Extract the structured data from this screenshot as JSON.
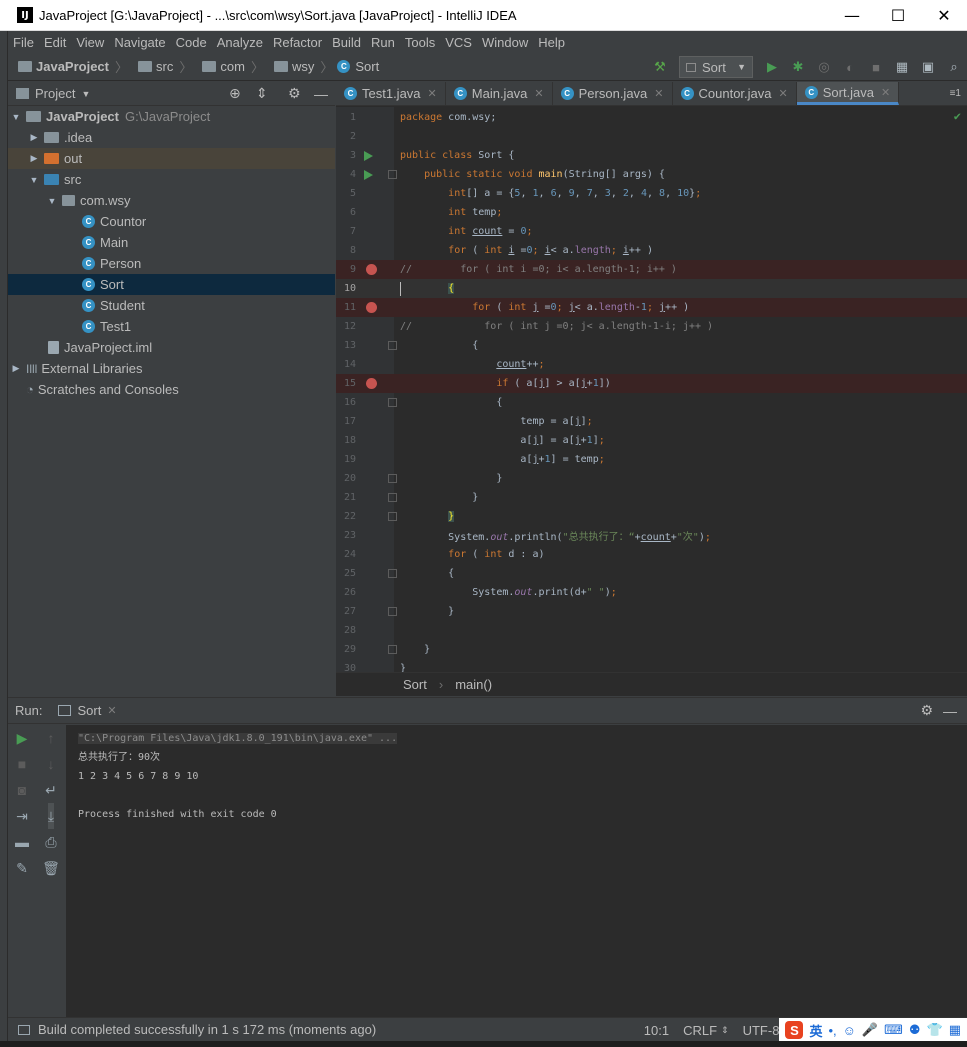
{
  "window": {
    "title": "JavaProject [G:\\JavaProject] - ...\\src\\com\\wsy\\Sort.java [JavaProject] - IntelliJ IDEA",
    "app_icon": "IJ"
  },
  "menu": [
    "File",
    "Edit",
    "View",
    "Navigate",
    "Code",
    "Analyze",
    "Refactor",
    "Build",
    "Run",
    "Tools",
    "VCS",
    "Window",
    "Help"
  ],
  "breadcrumb": {
    "project": "JavaProject",
    "items": [
      "src",
      "com",
      "wsy"
    ],
    "file": "Sort"
  },
  "run_config": {
    "label": "Sort"
  },
  "project_panel": {
    "title": "Project",
    "tree": {
      "root": {
        "label": "JavaProject",
        "path": "G:\\JavaProject"
      },
      "idea": ".idea",
      "out": "out",
      "src": "src",
      "pkg": "com.wsy",
      "classes": [
        "Countor",
        "Main",
        "Person",
        "Sort",
        "Student",
        "Test1"
      ],
      "iml": "JavaProject.iml",
      "ext": "External Libraries",
      "scratch": "Scratches and Consoles"
    }
  },
  "tabs": [
    "Test1.java",
    "Main.java",
    "Person.java",
    "Countor.java",
    "Sort.java"
  ],
  "tab_overflow": "≡1",
  "editor": {
    "line_numbers": [
      "1",
      "2",
      "3",
      "4",
      "5",
      "6",
      "7",
      "8",
      "9",
      "10",
      "11",
      "12",
      "13",
      "14",
      "15",
      "16",
      "17",
      "18",
      "19",
      "20",
      "21",
      "22",
      "23",
      "24",
      "25",
      "26",
      "27",
      "28",
      "29",
      "30"
    ],
    "footer": {
      "class": "Sort",
      "method": "main()"
    }
  },
  "run_panel": {
    "label": "Run:",
    "tab": "Sort",
    "console": [
      "\"C:\\Program Files\\Java\\jdk1.8.0_191\\bin\\java.exe\" ...",
      "总共执行了：90次",
      "1 2 3 4 5 6 7 8 9 10",
      "",
      "Process finished with exit code 0"
    ]
  },
  "status": {
    "message": "Build completed successfully in 1 s 172 ms (moments ago)",
    "position": "10:1",
    "line_sep": "CRLF",
    "encoding": "UTF-8",
    "ime_lang": "英"
  },
  "colors": {
    "accent": "#4a88c7",
    "breakpoint": "#c75450",
    "run_green": "#499c54"
  }
}
